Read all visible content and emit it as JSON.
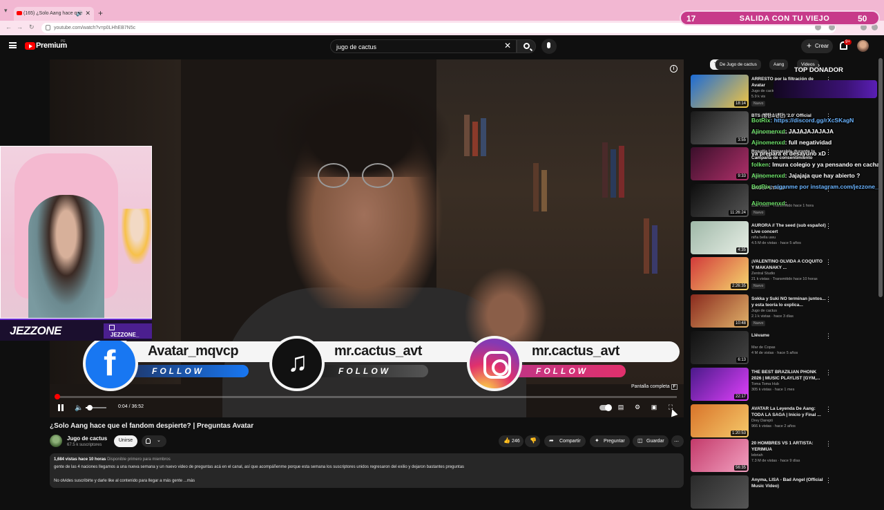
{
  "browser": {
    "tab_title": "(165) ¿Solo Aang hace que",
    "url": "youtube.com/watch?v=p0LHhEB7N5c"
  },
  "stream_banner": {
    "left_num": "17",
    "text": "SALIDA CON TU VIEJO",
    "right_num": "50"
  },
  "header": {
    "logo_text": "Premium",
    "logo_country": "PE",
    "search_value": "jugo de cactus",
    "create_label": "Crear",
    "notif_count": "9+"
  },
  "player": {
    "socials": [
      {
        "handle": "Avatar_mqvcp",
        "follow": "FOLLOW"
      },
      {
        "handle": "mr.cactus_avt",
        "follow": "FOLLOW"
      },
      {
        "handle": "mr.cactus_avt",
        "follow": "FOLLOW"
      }
    ],
    "fullscreen_hint": "Pantalla completa",
    "fullscreen_key": "F",
    "time": "0:04 / 36:52",
    "progress": 0.002,
    "volume": 0.18
  },
  "webcam": {
    "name": "JEZZONE",
    "twitch_name": "JEZZONE_"
  },
  "video": {
    "title": "¿Solo Aang hace que el fandom despierte? | Preguntas Avatar",
    "channel": "Jugo de cactus",
    "subs": "67.5 k suscriptores",
    "join": "Unirse",
    "likes": "246",
    "share": "Compartir",
    "ask": "Preguntar",
    "save": "Guardar",
    "desc_meta": "1,684 vistas  hace 10 horas",
    "desc_members": "Disponible primero para miembros",
    "desc_line1": "gente de las 4 naciones llegamos a una nueva semana y un nuevo video de preguntas acá en el canal, así que acompáñenme porque esta semana los suscriptores unidos regresaron del exilio y dejaron bastantes preguntas",
    "desc_line2": "No olvides suscribirte y darle like al contenido para llegar a más gente  ...más"
  },
  "sidebar": {
    "chips": [
      "Todos",
      "De Jugo de cactus",
      "Aang",
      "Videos"
    ],
    "donor_label": "TOP DONADOR",
    "recs": [
      {
        "title": "ARRESTO por la filtración de Avatar",
        "channel": "Jugo de cactus",
        "views": "5.9 k vis",
        "badge": "Nuevo",
        "dur": "18:14",
        "c1": "#1c6bd6",
        "c2": "#f2c542"
      },
      {
        "title": "BTS (방탄소년단) '2.0' Official",
        "channel": "",
        "views": "66 M de vistas · hace 3 semanas",
        "badge": "",
        "dur": "3:55",
        "c1": "#1a1a1a",
        "c2": "#6b6b6b"
      },
      {
        "title": "Rosalía | Imparable durante la Campaña de consentimiento",
        "channel": "",
        "views": "",
        "badge": "Nuevo",
        "dur": "9:33",
        "c1": "#3a0f2a",
        "c2": "#b0306a"
      },
      {
        "title": "GROUP STAGE",
        "channel": "",
        "views": "93 k vistas · Transmitido hace 1 hora",
        "badge": "Nuevo",
        "dur": "11:26:24",
        "c1": "#0d0d0d",
        "c2": "#555"
      },
      {
        "title": "AURORA // The seed (sub español) Live concert",
        "channel": "niña bella uwu",
        "views": "4.5 M de vistas · hace 5 años",
        "badge": "",
        "dur": "4:35",
        "c1": "#9fb8a8",
        "c2": "#e8efe6"
      },
      {
        "title": "¡VALENTINO OLVIDA A COQUITO Y MAKANAKY ...",
        "channel": "Zentral Studio",
        "views": "21 k vistas · Transmitido hace 10 horas",
        "badge": "Nuevo",
        "dur": "2:26:35",
        "c1": "#d23a3a",
        "c2": "#f5d76e"
      },
      {
        "title": "Sokka y Suki NO terminan juntos... y esta teoría lo explica...",
        "channel": "Jugo de cactus",
        "views": "2.1 k vistas · hace 3 días",
        "badge": "Nuevo",
        "dur": "10:48",
        "c1": "#8a2a1e",
        "c2": "#e0b26a"
      },
      {
        "title": "Llévame",
        "channel": "Mar de Copas",
        "views": "4 M de vistas · hace 5 años",
        "badge": "",
        "dur": "6:13",
        "c1": "#111",
        "c2": "#444"
      },
      {
        "title": "THE BEST BRAZILIAN PHONK 2026 | MUSIC PLAYLIST [GYM,...",
        "channel": "Toma Toma Hub",
        "views": "305 k vistas · hace 1 mes",
        "badge": "",
        "dur": "22:17",
        "c1": "#4a1a8a",
        "c2": "#e040fb"
      },
      {
        "title": "AVATAR La Leyenda De Aang: TODA LA SAGA | Inicio y Final ...",
        "channel": "Drey Darepti",
        "views": "966 k vistas · hace 2 años",
        "badge": "",
        "dur": "1:20:53",
        "c1": "#d9742a",
        "c2": "#f5c96a"
      },
      {
        "title": "20 HOMBRES VS 1 ARTISTA: YERIMUA",
        "channel": "lebriah",
        "views": "7.3 M de vistas · hace 9 días",
        "badge": "",
        "dur": "56:35",
        "c1": "#c33a6a",
        "c2": "#f2a0c0"
      },
      {
        "title": "Anyma, LISA - Bad Angel (Official Music Video)",
        "channel": "",
        "views": "",
        "badge": "",
        "dur": "",
        "c1": "#2a2a2a",
        "c2": "#555"
      }
    ]
  },
  "chat": [
    {
      "user": "BotRix",
      "msg": ": https://discord.gg/rXcSKagN",
      "link": true
    },
    {
      "user": "Ajinomenxd",
      "msg": ": JAJAJAJAJAJA"
    },
    {
      "user": "Ajinomenxd",
      "msg": ": full negatividad"
    },
    {
      "user": "",
      "msg": "ya prepara el desayuno xD"
    },
    {
      "user": "folken",
      "msg": ": Imura colegio y ya pensando en cachar"
    },
    {
      "user": "Ajinomenxd",
      "msg": ": Jajajaja que hay abierto ?"
    },
    {
      "user": "BotRix",
      "msg": ": síganme por instagram.com/jezzone_/",
      "link": true
    },
    {
      "user": "Ajinomenxd",
      "msg": ":"
    }
  ],
  "colors": {
    "yt_red": "#ff0000",
    "twitch_purple": "#6c2ad6",
    "banner": "#c73a8a"
  }
}
